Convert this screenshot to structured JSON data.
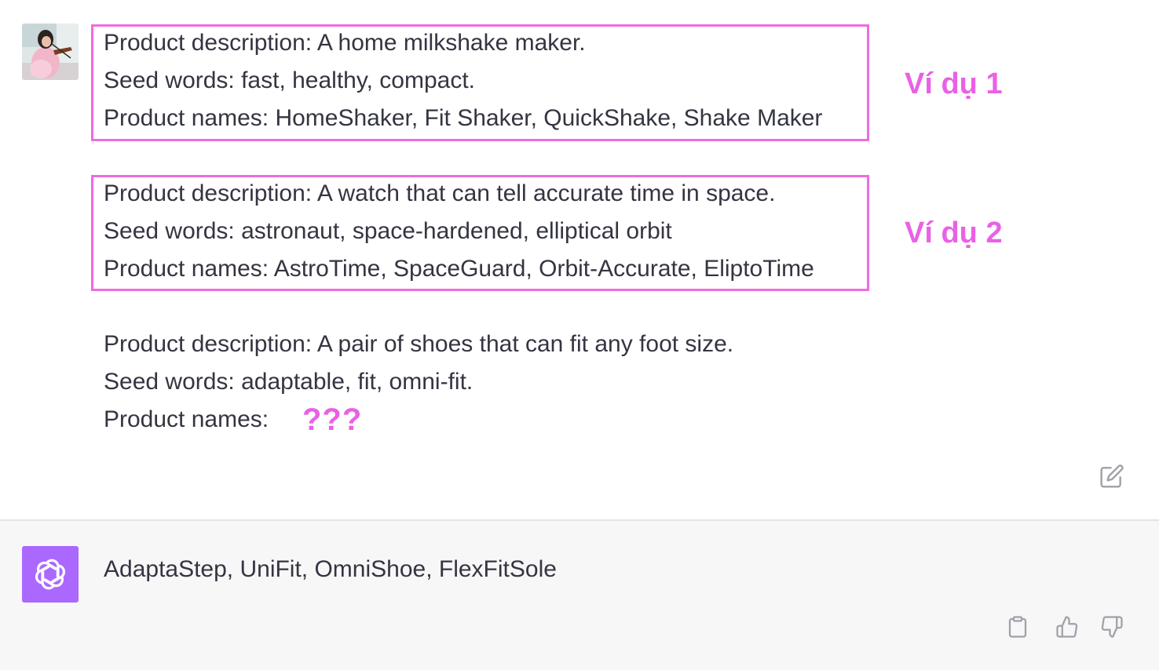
{
  "user_message": {
    "example1": {
      "description": "Product description: A home milkshake maker.",
      "seed_words": "Seed words: fast, healthy, compact.",
      "names": "Product names: HomeShaker, Fit Shaker, QuickShake, Shake Maker"
    },
    "example2": {
      "description": "Product description: A watch that can tell accurate time in space.",
      "seed_words": "Seed words: astronaut, space-hardened, elliptical orbit",
      "names": "Product names: AstroTime, SpaceGuard, Orbit-Accurate, EliptoTime"
    },
    "query": {
      "description": "Product description: A pair of shoes that can fit any foot size.",
      "seed_words": "Seed words: adaptable, fit, omni-fit.",
      "names": "Product names:"
    }
  },
  "annotations": {
    "example1_label": "Ví dụ 1",
    "example2_label": "Ví dụ 2",
    "unknown_marker": "???"
  },
  "assistant_message": {
    "text": "AdaptaStep, UniFit, OmniShoe, FlexFitSole"
  },
  "icons": {
    "user_avatar": "user-avatar-photo",
    "assistant_avatar": "openai-logo-icon",
    "edit": "edit-icon",
    "copy": "clipboard-icon",
    "thumbs_up": "thumbs-up-icon",
    "thumbs_down": "thumbs-down-icon"
  },
  "colors": {
    "highlight": "#e961e5",
    "assistant_avatar_bg": "#ab68ff",
    "assistant_bg": "#f7f7f8",
    "text": "#343541"
  }
}
